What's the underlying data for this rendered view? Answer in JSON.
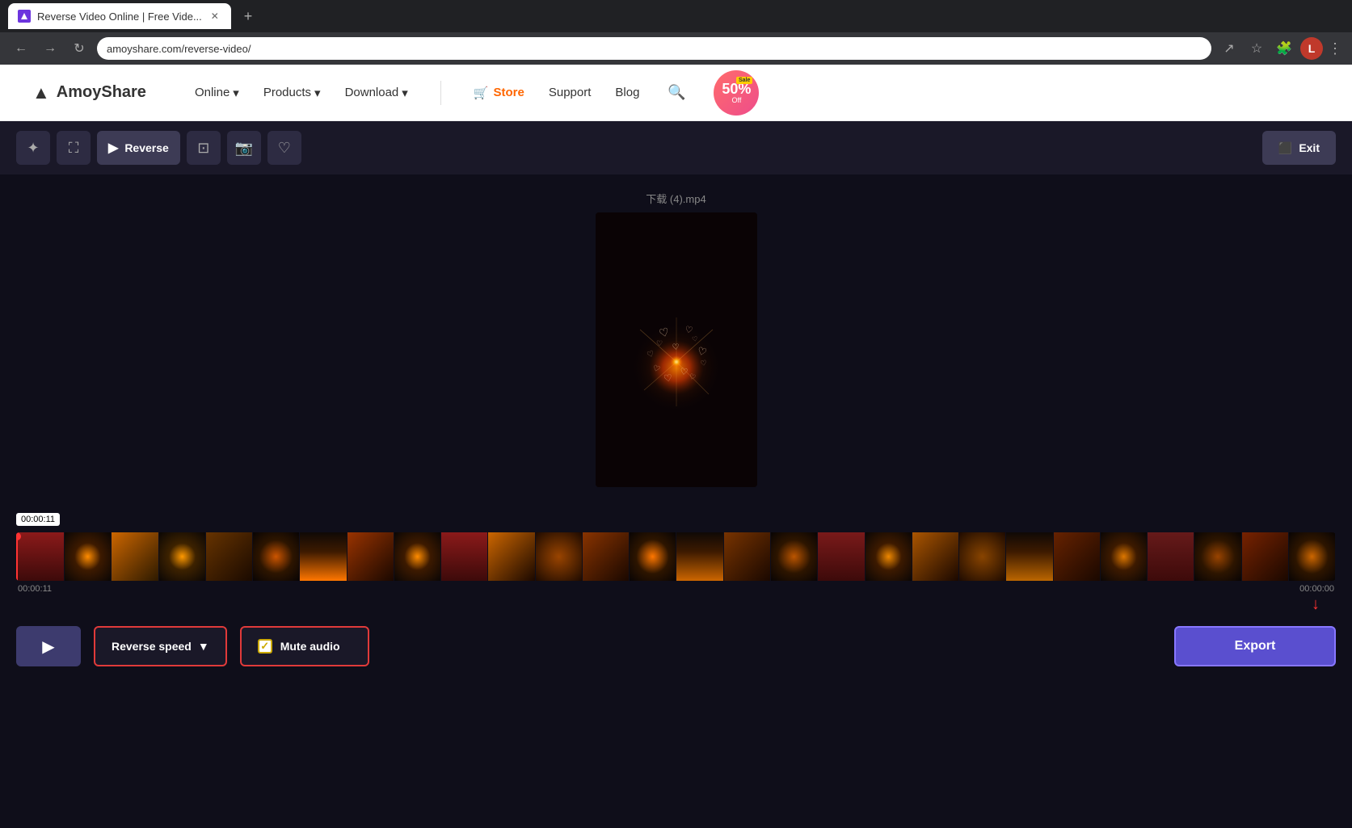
{
  "browser": {
    "tab_title": "Reverse Video Online | Free Vide...",
    "url": "amoyshare.com/reverse-video/",
    "new_tab_label": "+",
    "profile_initial": "L"
  },
  "header": {
    "logo_text": "AmoyShare",
    "nav": {
      "online": "Online",
      "products": "Products",
      "download": "Download",
      "store": "Store",
      "support": "Support",
      "blog": "Blog"
    },
    "sale": {
      "label": "Sale",
      "percent": "50%",
      "off": "Off"
    }
  },
  "toolbar": {
    "tools": [
      {
        "name": "magic-icon",
        "symbol": "✦"
      },
      {
        "name": "crop-icon",
        "symbol": "⛶"
      },
      {
        "name": "reverse-tool",
        "label": "Reverse",
        "active": true
      },
      {
        "name": "screenshot-icon",
        "symbol": "⊡"
      },
      {
        "name": "camera-icon",
        "symbol": "⊙"
      },
      {
        "name": "heart-icon",
        "symbol": "♡"
      }
    ],
    "exit_label": "Exit"
  },
  "video": {
    "filename": "下载 (4).mp4"
  },
  "timeline": {
    "start_time": "00:00:11",
    "end_time": "00:00:00",
    "display_time": "00:00:11",
    "frame_count": 28
  },
  "controls": {
    "play_label": "▶",
    "reverse_speed_label": "Reverse speed",
    "reverse_speed_dropdown": "▼",
    "mute_audio_label": "Mute audio",
    "mute_checked": true,
    "export_label": "Export"
  }
}
